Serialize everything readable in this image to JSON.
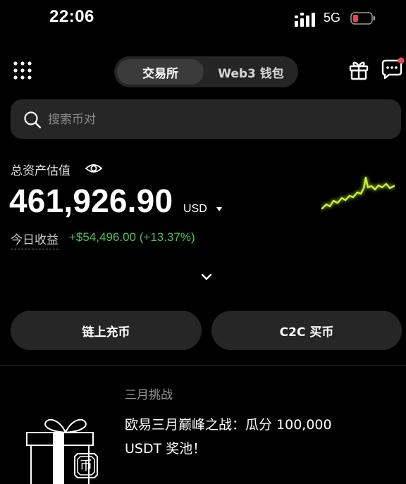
{
  "status_bar": {
    "time": "22:06",
    "network": "5G",
    "battery_color": "#e5484d"
  },
  "header": {
    "tabs": [
      {
        "label": "交易所",
        "active": true
      },
      {
        "label": "Web3 钱包",
        "active": false
      }
    ],
    "notification_dot_color": "#e5484d"
  },
  "search": {
    "placeholder": "搜索币对"
  },
  "assets": {
    "label": "总资产估值",
    "total": "461,926.90",
    "currency": "USD",
    "today_label": "今日收益",
    "today_change": "+$54,496.00 (+13.37%)",
    "positive_color": "#4fc05a",
    "sparkline_color": "#c6f432"
  },
  "actions": {
    "deposit_label": "链上充币",
    "c2c_label": "C2C 买币"
  },
  "promo": {
    "tag": "三月挑战",
    "title_line1": "欧易三月巅峰之战：瓜分 100,000",
    "title_line2": "USDT 奖池！",
    "coin_glyph": "币"
  }
}
